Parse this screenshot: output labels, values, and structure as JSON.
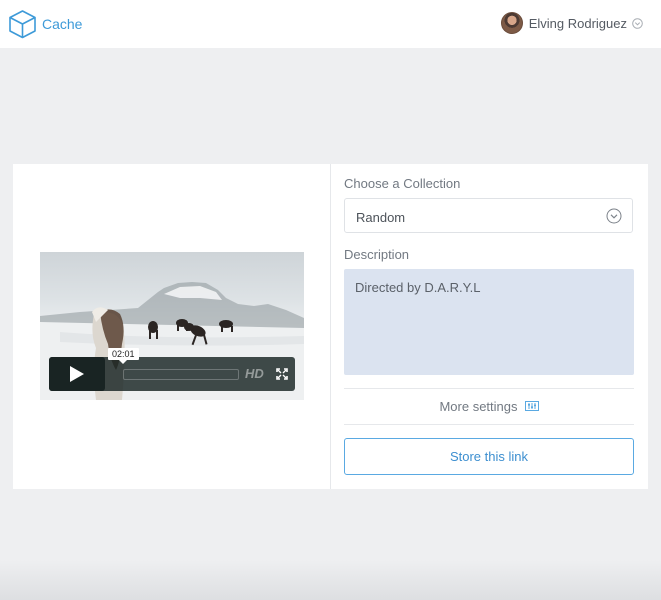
{
  "header": {
    "app_name": "Cache",
    "logo_icon": "cube-icon",
    "user": {
      "name": "Elving Rodriguez",
      "avatar_icon": "avatar",
      "menu_icon": "chevron-down-icon"
    }
  },
  "video": {
    "current_time": "02:01",
    "hd_label": "HD",
    "icons": {
      "play": "play-icon",
      "fullscreen": "fullscreen-icon"
    }
  },
  "form": {
    "collection_label": "Choose a Collection",
    "collection_value": "Random",
    "description_label": "Description",
    "description_value": "Directed by D.A.R.Y.L",
    "more_settings_label": "More settings",
    "more_settings_icon": "sliders-icon",
    "store_button_label": "Store this link"
  },
  "colors": {
    "accent": "#3d9ad8",
    "page_background": "#eeeff1",
    "description_background": "#dbe3f0"
  }
}
